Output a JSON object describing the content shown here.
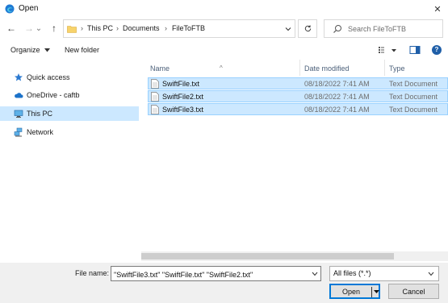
{
  "window": {
    "title": "Open",
    "close_glyph": "✕"
  },
  "nav": {
    "back_glyph": "←",
    "forward_glyph": "→",
    "recent_glyph": "⌄",
    "up_glyph": "↑"
  },
  "address": {
    "crumbs": [
      "This PC",
      "Documents",
      "FileToFTB"
    ],
    "separator": "›",
    "lead_separator": "›"
  },
  "search": {
    "placeholder": "Search FileToFTB"
  },
  "toolbar": {
    "organize_label": "Organize",
    "new_folder_label": "New folder"
  },
  "sidebar": {
    "items": [
      {
        "label": "Quick access",
        "icon": "star-icon"
      },
      {
        "label": "OneDrive - caftb",
        "icon": "cloud-icon"
      },
      {
        "label": "This PC",
        "icon": "computer-icon"
      },
      {
        "label": "Network",
        "icon": "network-icon"
      }
    ]
  },
  "filelist": {
    "columns": [
      "Name",
      "Date modified",
      "Type"
    ],
    "rows": [
      {
        "name": "SwiftFile.txt",
        "date": "08/18/2022 7:41 AM",
        "type": "Text Document"
      },
      {
        "name": "SwiftFile2.txt",
        "date": "08/18/2022 7:41 AM",
        "type": "Text Document"
      },
      {
        "name": "SwiftFile3.txt",
        "date": "08/18/2022 7:41 AM",
        "type": "Text Document"
      }
    ]
  },
  "footer": {
    "file_name_label": "File name:",
    "file_name_value": "\"SwiftFile3.txt\" \"SwiftFile.txt\" \"SwiftFile2.txt\"",
    "filter_value": "All files (*.*)",
    "open_label": "Open",
    "cancel_label": "Cancel"
  },
  "colors": {
    "selection_bg": "#cce8ff",
    "selection_border": "#99d1ff",
    "accent": "#0078d7"
  }
}
